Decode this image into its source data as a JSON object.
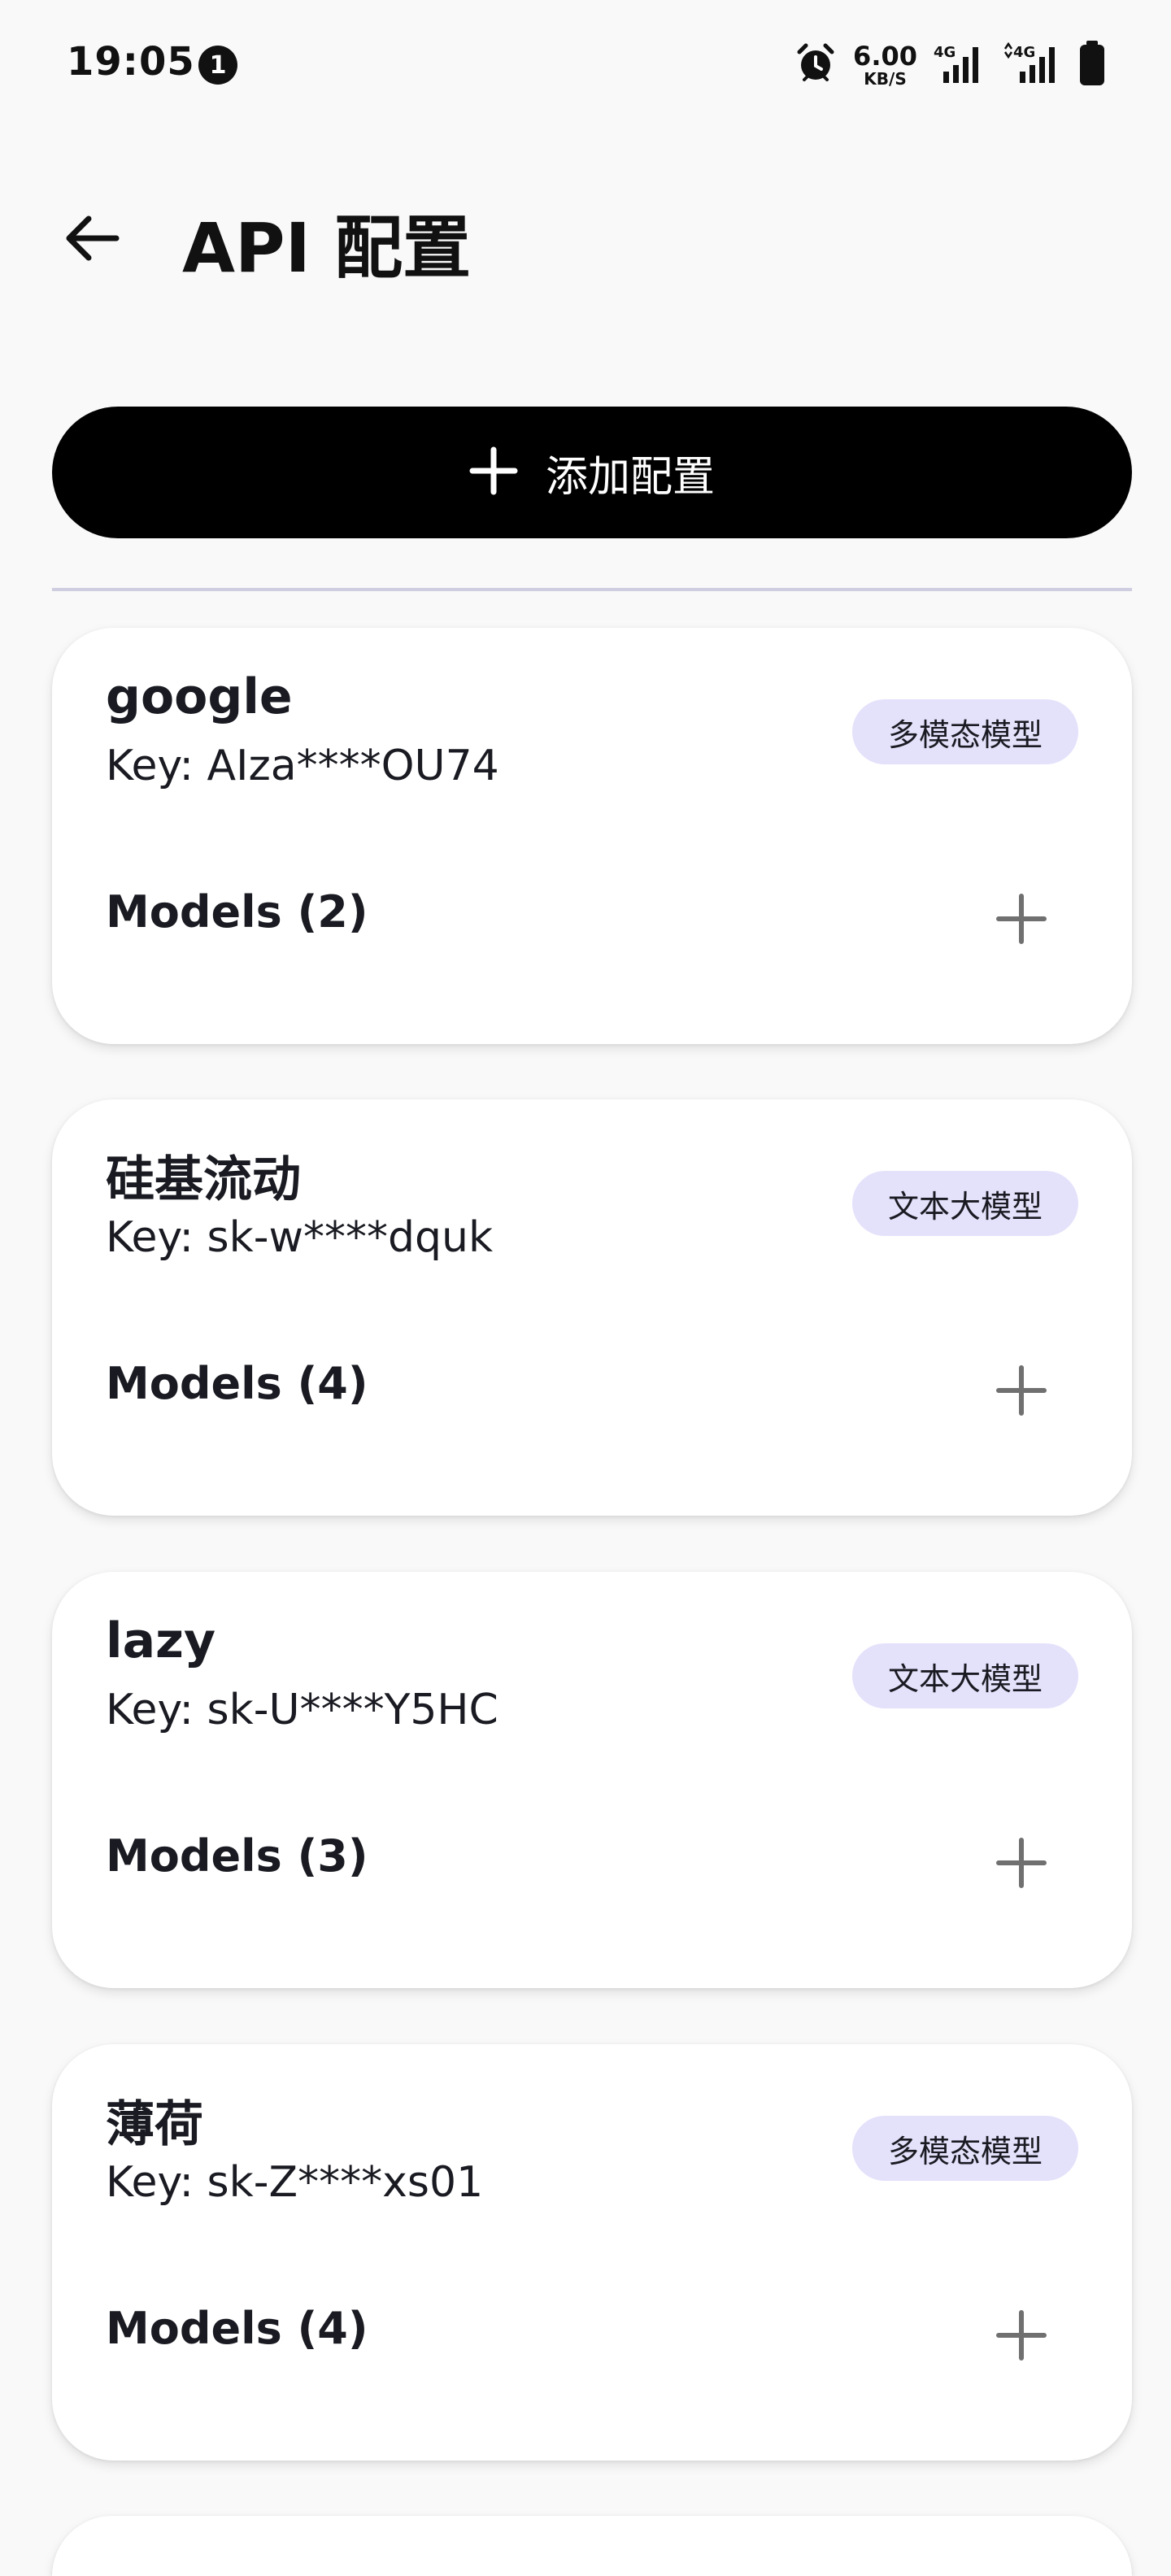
{
  "status_bar": {
    "time": "19:05",
    "notification_count": "1",
    "net_speed_value": "6.00",
    "net_speed_unit": "KB/S",
    "icons": [
      "alarm-icon",
      "signal-4g-icon",
      "signal-4g-icon",
      "battery-icon"
    ]
  },
  "app_bar": {
    "title": "API 配置",
    "back_icon": "arrow-left-icon"
  },
  "add_button": {
    "label": "添加配置",
    "icon": "plus-icon"
  },
  "configs": [
    {
      "name": "google",
      "key": "Key: AIza****OU74",
      "badge": "多模态模型",
      "models": "Models (2)"
    },
    {
      "name": "硅基流动",
      "key": "Key: sk-w****dquk",
      "badge": "文本大模型",
      "models": "Models (4)"
    },
    {
      "name": "lazy",
      "key": "Key: sk-U****Y5HC",
      "badge": "文本大模型",
      "models": "Models (3)"
    },
    {
      "name": "薄荷",
      "key": "Key: sk-Z****xs01",
      "badge": "多模态模型",
      "models": "Models (4)"
    },
    {
      "name": "",
      "key": "",
      "badge": "",
      "models": ""
    }
  ],
  "colors": {
    "background": "#f9f9f9",
    "primary_button": "#000000",
    "badge_bg": "#e4e1fb",
    "divider": "#cfcde0",
    "card_bg": "#ffffff"
  }
}
